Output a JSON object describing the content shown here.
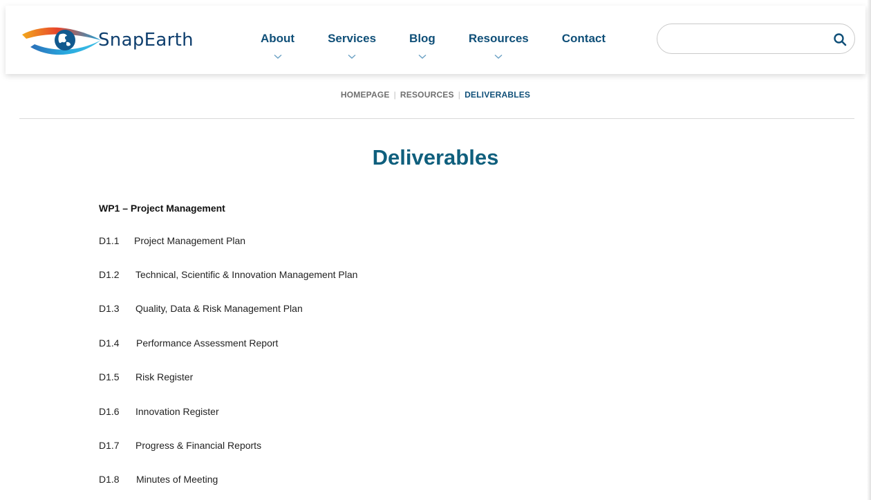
{
  "brand": {
    "name": "SnapEarth"
  },
  "nav": {
    "items": [
      {
        "label": "About",
        "has_dropdown": true
      },
      {
        "label": "Services",
        "has_dropdown": true
      },
      {
        "label": "Blog",
        "has_dropdown": true
      },
      {
        "label": "Resources",
        "has_dropdown": true
      },
      {
        "label": "Contact",
        "has_dropdown": false
      }
    ]
  },
  "search": {
    "value": "",
    "placeholder": ""
  },
  "breadcrumb": {
    "items": [
      "HOMEPAGE",
      "RESOURCES",
      "DELIVERABLES"
    ]
  },
  "page": {
    "title": "Deliverables",
    "section": "WP1 – Project Management",
    "deliverables": [
      {
        "code": "D1.1",
        "name": "Project Management Plan"
      },
      {
        "code": "D1.2",
        "name": "Technical, Scientific & Innovation Management Plan"
      },
      {
        "code": "D1.3",
        "name": "Quality, Data & Risk Management Plan"
      },
      {
        "code": "D1.4",
        "name": "Performance Assessment Report"
      },
      {
        "code": "D1.5",
        "name": "Risk Register"
      },
      {
        "code": "D1.6",
        "name": "Innovation Register"
      },
      {
        "code": "D1.7",
        "name": "Progress & Financial Reports"
      },
      {
        "code": "D1.8",
        "name": "Minutes of Meeting"
      }
    ]
  },
  "colors": {
    "nav": "#0f4f78",
    "title": "#0f5f7d",
    "breadcrumb_current": "#0f4f78",
    "breadcrumb_inactive": "#6f6f6f"
  },
  "icons": {
    "logo": "eye-globe-logo-icon",
    "nav_dropdown": "chevron-down-icon",
    "search": "search-icon"
  }
}
